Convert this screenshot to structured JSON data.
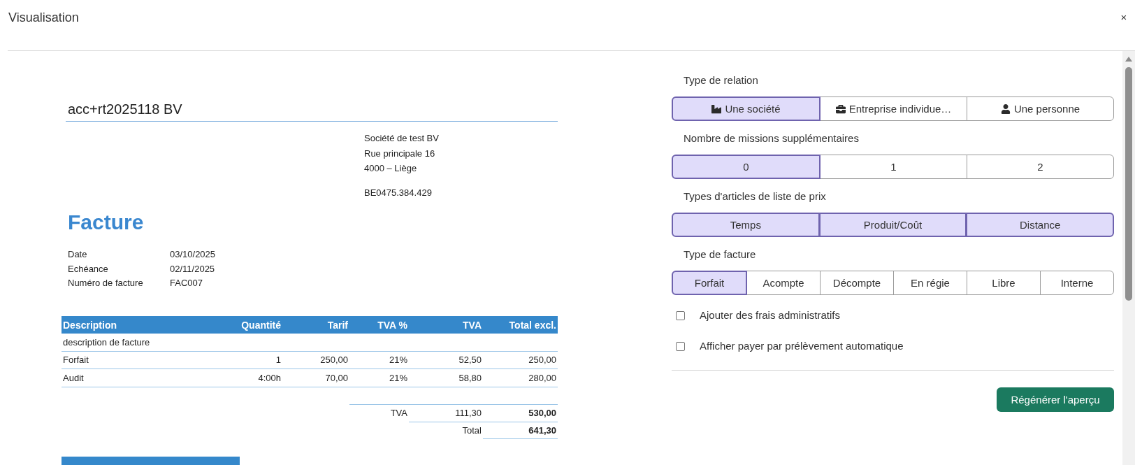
{
  "window": {
    "title": "Visualisation",
    "close": "×"
  },
  "document": {
    "client_name": "acc+rt2025118 BV",
    "address": [
      "Société de test BV",
      "Rue principale 16",
      "4000 – Liège"
    ],
    "vat_number": "BE0475.384.429",
    "heading": "Facture",
    "details": [
      {
        "label": "Date",
        "value": "03/10/2025"
      },
      {
        "label": "Echéance",
        "value": "02/11/2025"
      },
      {
        "label": "Numéro de facture",
        "value": "FAC007"
      }
    ],
    "table": {
      "columns": [
        "Description",
        "Quantité",
        "Tarif",
        "TVA %",
        "TVA",
        "Total excl."
      ],
      "rows": [
        {
          "kind": "note",
          "cells": [
            "description de facture"
          ]
        },
        {
          "kind": "line",
          "cells": [
            "Forfait",
            "1",
            "250,00",
            "21%",
            "52,50",
            "250,00"
          ]
        },
        {
          "kind": "line",
          "cells": [
            "Audit",
            "4:00h",
            "70,00",
            "21%",
            "58,80",
            "280,00"
          ]
        }
      ]
    },
    "totals": [
      {
        "cells": [
          "TVA",
          "111,30",
          "530,00"
        ]
      },
      {
        "cells": [
          "Total",
          "641,30"
        ]
      }
    ]
  },
  "options": {
    "groups": [
      {
        "label": "Type de relation",
        "kind": "icon",
        "choices": [
          {
            "label": "Une société",
            "selected": true
          },
          {
            "label": "Entreprise individue…",
            "selected": false
          },
          {
            "label": "Une personne",
            "selected": false
          }
        ]
      },
      {
        "label": "Nombre de missions supplémentaires",
        "kind": "text",
        "choices": [
          {
            "label": "0",
            "selected": true
          },
          {
            "label": "1",
            "selected": false
          },
          {
            "label": "2",
            "selected": false
          }
        ]
      },
      {
        "label": "Types d'articles de liste de prix",
        "kind": "text",
        "choices": [
          {
            "label": "Temps",
            "selected": true
          },
          {
            "label": "Produit/Coût",
            "selected": true
          },
          {
            "label": "Distance",
            "selected": true
          }
        ]
      },
      {
        "label": "Type de facture",
        "kind": "text",
        "choices": [
          {
            "label": "Forfait",
            "selected": true
          },
          {
            "label": "Acompte",
            "selected": false
          },
          {
            "label": "Décompte",
            "selected": false
          },
          {
            "label": "En régie",
            "selected": false
          },
          {
            "label": "Libre",
            "selected": false
          },
          {
            "label": "Interne",
            "selected": false
          }
        ]
      }
    ],
    "checkboxes": [
      {
        "label": "Ajouter des frais administratifs",
        "checked": false
      },
      {
        "label": "Afficher payer par prélèvement automatique",
        "checked": false
      }
    ],
    "button": "Régénérer l'aperçu"
  }
}
